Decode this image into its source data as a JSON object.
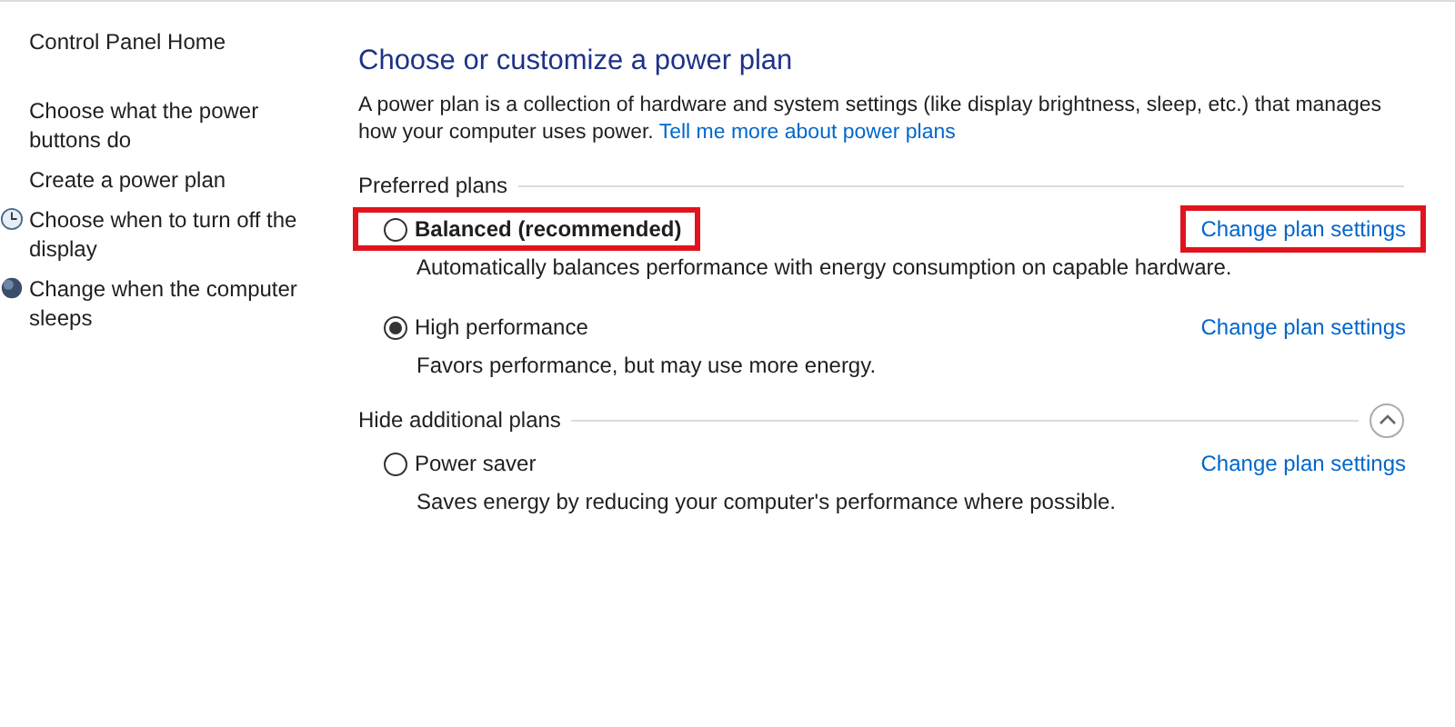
{
  "sidebar": {
    "items": [
      {
        "label": "Control Panel Home",
        "kind": "home"
      },
      {
        "label": "Choose what the power buttons do",
        "kind": "link"
      },
      {
        "label": "Create a power plan",
        "kind": "link"
      },
      {
        "label": "Choose when to turn off the display",
        "kind": "clock"
      },
      {
        "label": "Change when the computer sleeps",
        "kind": "moon"
      }
    ]
  },
  "title": "Choose or customize a power plan",
  "intro": "A power plan is a collection of hardware and system settings (like display brightness, sleep, etc.) that manages how your computer uses power.",
  "intro_link": "Tell me more about power plans",
  "groups": [
    {
      "heading": "Preferred plans",
      "collapse_button": false,
      "plans": [
        {
          "name": "Balanced (recommended)",
          "selected": false,
          "bold": true,
          "highlighted": true,
          "description": "Automatically balances performance with energy consumption on capable hardware.",
          "link": "Change plan settings",
          "link_highlighted": true
        },
        {
          "name": "High performance",
          "selected": true,
          "bold": false,
          "highlighted": false,
          "description": "Favors performance, but may use more energy.",
          "link": "Change plan settings",
          "link_highlighted": false
        }
      ]
    },
    {
      "heading": "Hide additional plans",
      "collapse_button": true,
      "plans": [
        {
          "name": "Power saver",
          "selected": false,
          "bold": false,
          "highlighted": false,
          "description": "Saves energy by reducing your computer's performance where possible.",
          "link": "Change plan settings",
          "link_highlighted": false
        }
      ]
    }
  ]
}
